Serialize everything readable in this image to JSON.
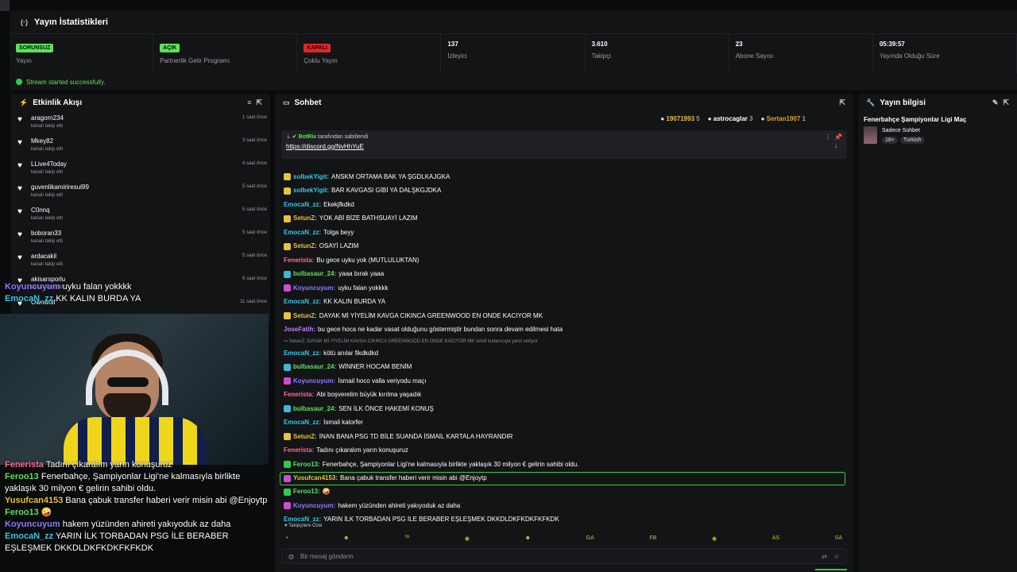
{
  "stats": {
    "title": "Yayın İstatistikleri",
    "items": [
      {
        "badge": "SORUNSUZ",
        "badge_color": "#5be35b",
        "label": "Yayın"
      },
      {
        "badge": "AÇIK",
        "badge_color": "#5be35b",
        "label": "Partnerlik Gelir Programı"
      },
      {
        "badge": "KAPALI",
        "badge_color": "#e0262b",
        "label": "Çoklu Yayın"
      },
      {
        "value": "137",
        "label": "İzleyici"
      },
      {
        "value": "3.610",
        "label": "Takipçi"
      },
      {
        "value": "23",
        "label": "Abone Sayısı"
      },
      {
        "value": "05:39:57",
        "label": "Yayında Olduğu Süre"
      }
    ],
    "success": "Stream started successfully."
  },
  "activity": {
    "title": "Etkinlik Akışı",
    "items": [
      {
        "name": "aragorn234",
        "sub": "kanalı takip etti",
        "time": "1 saat önce"
      },
      {
        "name": "Mkey82",
        "sub": "kanalı takip etti",
        "time": "3 saat önce"
      },
      {
        "name": "LLive4Today",
        "sub": "kanalı takip etti",
        "time": "4 saat önce"
      },
      {
        "name": "guvenlikamiriresul99",
        "sub": "kanalı takip etti",
        "time": "5 saat önce"
      },
      {
        "name": "C0nnq",
        "sub": "kanalı takip etti",
        "time": "5 saat önce"
      },
      {
        "name": "boboran33",
        "sub": "kanalı takip etti",
        "time": "5 saat önce"
      },
      {
        "name": "ardacakil",
        "sub": "kanalı takip etti",
        "time": "5 saat önce"
      },
      {
        "name": "akisarsporlu",
        "sub": "kanalı takip etti",
        "time": "6 saat önce"
      },
      {
        "name": "Ownwolf",
        "sub": "",
        "time": "11 saat önce"
      }
    ]
  },
  "overlay_top": [
    {
      "user": "Koyuncuyum",
      "text": "uyku falan yokkkk",
      "color": "#8f7bff"
    },
    {
      "user": "EmocaN_zz",
      "text": "KK KALIN BURDA YA",
      "color": "#35c8e6"
    }
  ],
  "overlay_bottom": [
    {
      "user": "Fenerista",
      "text": "Tadını çıkaralım yarın konuşuruz",
      "color": "#ff6a9a"
    },
    {
      "user": "Feroo13",
      "text": "Fenerbahçe, Şampiyonlar Ligi'ne kalmasıyla birlikte yaklaşık 30 milyon € gelirin sahibi oldu.",
      "color": "#5be35b"
    },
    {
      "user": "Yusufcan4153",
      "text": "Bana çabuk transfer haberi verir misin abi @Enjoytp",
      "color": "#e8c33b"
    },
    {
      "user": "Feroo13",
      "text": "🤪",
      "color": "#5be35b"
    },
    {
      "user": "Koyuncuyum",
      "text": "hakem yüzünden ahireti yakıyoduk az daha",
      "color": "#8f7bff"
    },
    {
      "user": "EmocaN_zz",
      "text": "YARIN İLK TORBADAN PSG İLE BERABER EŞLEŞMEK DKKDLDKFKDKFKFKDK",
      "color": "#35c8e6"
    }
  ],
  "chat": {
    "title": "Sohbet",
    "top_viewers": [
      {
        "name": "19071993",
        "count": "5",
        "color": "#e8c33b"
      },
      {
        "name": "astrocaglar",
        "count": "3",
        "color": "#ffffff"
      },
      {
        "name": "Sertan1907",
        "count": "1",
        "color": "#e0a42a"
      }
    ],
    "pinned_by_user": "BotRix",
    "pinned_by_text": "tarafından sabitlendi",
    "pinned_link": "https://discord.gg/NvHhYuE",
    "messages": [
      {
        "icon": "y",
        "user": "solbekYigit",
        "color": "#35c8e6",
        "text": "ANSKM ORTAMA BAK YA ŞGDLKAJGKA"
      },
      {
        "icon": "y",
        "user": "solbekYigit",
        "color": "#35c8e6",
        "text": "BAR KAVGASI GİBİ YA DALŞKGJDKA"
      },
      {
        "icon": "",
        "user": "EmocaN_zz",
        "color": "#35c8e6",
        "text": "Ekekjfkdkd"
      },
      {
        "icon": "y",
        "user": "SetunZ",
        "color": "#e8c33b",
        "text": "YOK ABİ BİZE BATHSUAYİ LAZIM"
      },
      {
        "icon": "",
        "user": "EmocaN_zz",
        "color": "#35c8e6",
        "text": "Tolga beyy"
      },
      {
        "icon": "y",
        "user": "SetunZ",
        "color": "#e8c33b",
        "text": "OSAYİ LAZIM"
      },
      {
        "icon": "",
        "user": "Fenerista",
        "color": "#ff6a9a",
        "text": "Bu gece uyku yok (MUTLULUKTAN)"
      },
      {
        "icon": "t",
        "user": "bulbasaur_24",
        "color": "#5be35b",
        "text": "yaaa bırak yaaa"
      },
      {
        "icon": "p",
        "user": "Koyuncuyum",
        "color": "#8f7bff",
        "text": "uyku falan yokkkk"
      },
      {
        "icon": "",
        "user": "EmocaN_zz",
        "color": "#35c8e6",
        "text": "KK KALIN BURDA YA"
      },
      {
        "icon": "y",
        "user": "SetunZ",
        "color": "#e8c33b",
        "text": "DAYAK Mİ YİYELİM KAVGA CIKINCA GREENWOOD EN ONDE KACIYOR MK"
      },
      {
        "icon": "",
        "user": "JoseFatih",
        "color": "#c27bff",
        "text": "bu gece hoca ne kadar vasat olduğunu göstermiştir bundan sonra devam edilmesi hata"
      },
      {
        "reply": true,
        "text": "↪ SetunZ: DAYAK Mİ YİYELİM KAVGA CIKINCA GREENWOOD EN ONDE KACIYOR MK isimli kullanıcıya yanıt veriyor"
      },
      {
        "icon": "",
        "user": "EmocaN_zz",
        "color": "#35c8e6",
        "text": "kötü anılar fikdkdkd"
      },
      {
        "icon": "t",
        "user": "bulbasaur_24",
        "color": "#5be35b",
        "text": "WİNNER HOCAM BENİM"
      },
      {
        "icon": "p",
        "user": "Koyuncuyum",
        "color": "#8f7bff",
        "text": "İsmail hoco valla veriyodu maçı"
      },
      {
        "icon": "",
        "user": "Fenerista",
        "color": "#ff6a9a",
        "text": "Abi boşverelim büyük kırılma yaşadık"
      },
      {
        "icon": "t",
        "user": "bulbasaur_24",
        "color": "#5be35b",
        "text": "SEN İLK ÖNCE HAKEMİ KONUŞ"
      },
      {
        "icon": "",
        "user": "EmocaN_zz",
        "color": "#35c8e6",
        "text": "İsmail kalorfer"
      },
      {
        "icon": "y",
        "user": "SetunZ",
        "color": "#e8c33b",
        "text": "İNAN BANA PSG TD BİLE SUANDA İSMAİL KARTALA HAYRANDIR"
      },
      {
        "icon": "",
        "user": "Fenerista",
        "color": "#ff6a9a",
        "text": "Tadını çıkaralım yarın konuşuruz"
      },
      {
        "icon": "g",
        "user": "Feroo13",
        "color": "#5be35b",
        "text": "Fenerbahçe, Şampiyonlar Ligi'ne kalmasıyla birlikte yaklaşık 30 milyon € gelirin sahibi oldu."
      },
      {
        "icon": "p",
        "user": "Yusufcan4153",
        "color": "#e8c33b",
        "text": "Bana çabuk transfer haberi verir misin abi @Enjoytp",
        "highlight": true
      },
      {
        "icon": "g",
        "user": "Feroo13",
        "color": "#5be35b",
        "text": "🤪"
      },
      {
        "icon": "p",
        "user": "Koyuncuyum",
        "color": "#8f7bff",
        "text": "hakem yüzünden ahireti yakıyoduk az daha"
      },
      {
        "icon": "",
        "user": "EmocaN_zz",
        "color": "#35c8e6",
        "text": "YARIN İLK TORBADAN PSG İLE BERABER EŞLEŞMEK DKKDLDKFKDKFKFKDK"
      }
    ],
    "followers_label": "♥ Takipçilere Özel",
    "emotes": [
      "•",
      "☻",
      "ᵀᴿ",
      "◉",
      "☻",
      "GA",
      "FB",
      "◉",
      "AS",
      "SA"
    ],
    "input_placeholder": "Bir mesaj gönderin"
  },
  "info": {
    "title": "Yayın bilgisi",
    "stream_title": "Fenerbahçe Şampiyonlar Ligi Maç",
    "category": "Sadece Sohbet",
    "tags": [
      "18+",
      "Turkish"
    ]
  }
}
